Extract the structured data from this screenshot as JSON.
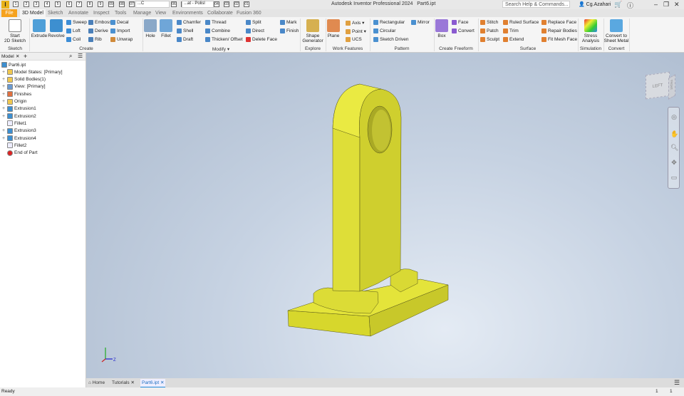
{
  "app": {
    "title": "Autodesk Inventor Professional 2024",
    "document": "Part6.ipt",
    "logo": "I",
    "search_placeholder": "Search Help & Commands...",
    "user": "Cg.Azahari",
    "quick_access_keys": [
      "1",
      "2",
      "3",
      "4",
      "5",
      "6",
      "7",
      "8",
      "9",
      "09",
      "08",
      "07",
      "06",
      "05",
      "04",
      "03",
      "02",
      "01"
    ],
    "style_combo": "...C",
    "appearance_combo": "...at - Polisl"
  },
  "tabs": [
    {
      "label": "File",
      "key": "F"
    },
    {
      "label": "3D Model",
      "key": "M"
    },
    {
      "label": "Sketch",
      "key": "S"
    },
    {
      "label": "Annotate",
      "key": "Q"
    },
    {
      "label": "Inspect",
      "key": "N"
    },
    {
      "label": "Tools",
      "key": "T"
    },
    {
      "label": "Manage",
      "key": "G"
    },
    {
      "label": "View",
      "key": "V"
    },
    {
      "label": "Environments",
      "key": "E"
    },
    {
      "label": "Collaborate",
      "key": "OL"
    },
    {
      "label": "Fusion 360",
      "key": "O3"
    }
  ],
  "ribbon": {
    "sketch": {
      "label": "Sketch",
      "start": "Start\n2D Sketch"
    },
    "create": {
      "label": "Create",
      "extrude": "Extrude",
      "revolve": "Revolve",
      "items": [
        "Sweep",
        "Loft",
        "Coil",
        "Emboss",
        "Derive",
        "Rib",
        "Decal",
        "Import",
        "Unwrap"
      ]
    },
    "modify": {
      "label": "Modify ▾",
      "hole": "Hole",
      "fillet": "Fillet",
      "items": [
        "Chamfer",
        "Shell",
        "Draft",
        "Thread",
        "Combine",
        "Thicken/ Offset",
        "Split",
        "Direct",
        "Delete Face",
        "Mark",
        "Finish"
      ]
    },
    "explore": {
      "label": "Explore",
      "shape": "Shape\nGenerator"
    },
    "work": {
      "label": "Work Features",
      "plane": "Plane",
      "items": [
        "Axis ▾",
        "Point ▾",
        "UCS"
      ]
    },
    "pattern": {
      "label": "Pattern",
      "items": [
        "Rectangular",
        "Circular",
        "Sketch Driven",
        "Mirror"
      ]
    },
    "freeform": {
      "label": "Create Freeform",
      "box": "Box",
      "items": [
        "Face",
        "Convert"
      ]
    },
    "surface": {
      "label": "Surface",
      "items": [
        "Stitch",
        "Patch",
        "Sculpt",
        "Ruled Surface",
        "Trim",
        "Extend",
        "Replace Face",
        "Repair Bodies",
        "Fit Mesh Face"
      ]
    },
    "simulation": {
      "label": "Simulation",
      "stress": "Stress\nAnalysis"
    },
    "convert": {
      "label": "Convert",
      "sheet": "Convert to\nSheet Metal"
    }
  },
  "browser": {
    "tab": "Model",
    "items": [
      {
        "label": "Part6.ipt",
        "icon": "part",
        "exp": false,
        "indent": 0
      },
      {
        "label": "Model States: [Primary]",
        "icon": "folder",
        "exp": true,
        "indent": 1
      },
      {
        "label": "Solid Bodies(1)",
        "icon": "folder",
        "exp": true,
        "indent": 1
      },
      {
        "label": "View: [Primary]",
        "icon": "view",
        "exp": true,
        "indent": 1
      },
      {
        "label": "Finishes",
        "icon": "finish",
        "exp": true,
        "indent": 1
      },
      {
        "label": "Origin",
        "icon": "folder",
        "exp": true,
        "indent": 1
      },
      {
        "label": "Extrusion1",
        "icon": "extrude",
        "exp": true,
        "indent": 1
      },
      {
        "label": "Extrusion2",
        "icon": "extrude",
        "exp": true,
        "indent": 1
      },
      {
        "label": "Fillet1",
        "icon": "fillet",
        "exp": false,
        "indent": 1
      },
      {
        "label": "Extrusion3",
        "icon": "extrude",
        "exp": true,
        "indent": 1
      },
      {
        "label": "Extrusion4",
        "icon": "extrude",
        "exp": true,
        "indent": 1
      },
      {
        "label": "Fillet2",
        "icon": "fillet",
        "exp": false,
        "indent": 1
      },
      {
        "label": "End of Part",
        "icon": "end",
        "exp": false,
        "indent": 1
      }
    ]
  },
  "viewcube": {
    "face": "LEFT",
    "side": "FRONT"
  },
  "doctabs": [
    {
      "label": "Home"
    },
    {
      "label": "Tutorials ✕"
    },
    {
      "label": "Part6.ipt ✕",
      "active": true
    }
  ],
  "status": {
    "text": "Ready",
    "count1": "1",
    "count2": "1"
  },
  "colors": {
    "part": "#e6e635",
    "file_tab": "#f6a21e",
    "accent": "#1e88d8"
  }
}
